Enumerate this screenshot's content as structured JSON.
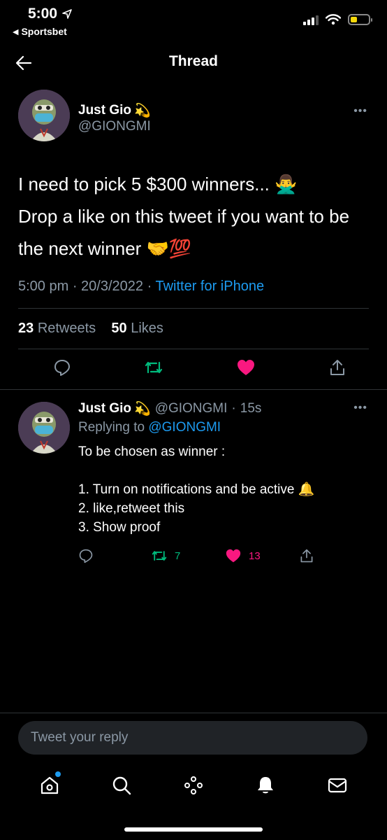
{
  "status_bar": {
    "time": "5:00",
    "back_app": "Sportsbet"
  },
  "header": {
    "title": "Thread"
  },
  "main_tweet": {
    "display_name": "Just Gio",
    "name_emoji": "💫",
    "handle": "@GIONGMI",
    "text_line1": "I need to pick 5 $300 winners... 🙅‍♂️",
    "text_line2": "Drop a like on this tweet if you want to be the next winner 🤝💯",
    "time": "5:00 pm",
    "date": "20/3/2022",
    "source": "Twitter for iPhone",
    "retweets_count": "23",
    "retweets_label": "Retweets",
    "likes_count": "50",
    "likes_label": "Likes"
  },
  "reply": {
    "display_name": "Just Gio",
    "name_emoji": "💫",
    "handle": "@GIONGMI",
    "age": "15s",
    "replying_label": "Replying to",
    "replying_to": "@GIONGMI",
    "text": "To be chosen as winner :\n\n1. Turn on notifications and be active 🔔\n2. like,retweet this\n3. Show proof",
    "retweet_count": "7",
    "like_count": "13"
  },
  "compose": {
    "placeholder": "Tweet your reply"
  },
  "colors": {
    "background": "#000000",
    "accent": "#1d9bf0",
    "retweet_green": "#00ba7c",
    "like_pink": "#f91880",
    "secondary_text": "#8b98a5"
  },
  "icons": {
    "back": "arrow-left-icon",
    "more": "more-dots-icon",
    "reply": "comment-icon",
    "retweet": "retweet-icon",
    "like": "heart-icon",
    "share": "share-icon",
    "home": "home-icon",
    "search": "search-icon",
    "spaces": "spaces-icon",
    "notifications": "bell-icon",
    "messages": "mail-icon"
  }
}
